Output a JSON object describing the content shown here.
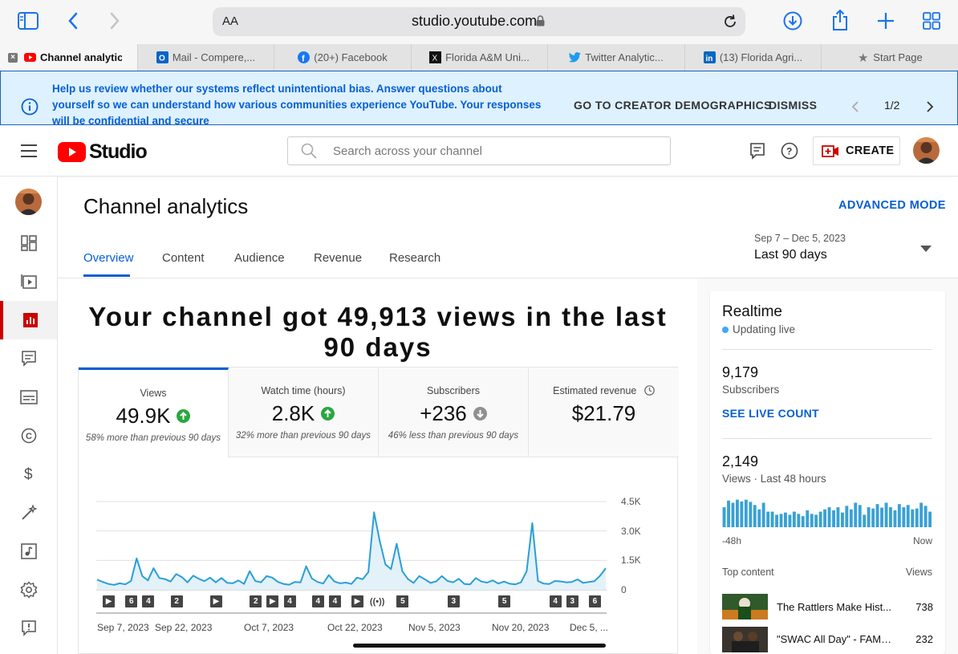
{
  "browser": {
    "text_size": "AA",
    "url": "studio.youtube.com",
    "tabs": [
      {
        "label": "Channel analytics",
        "favicon": "youtube-icon",
        "active": true
      },
      {
        "label": "Mail - Compere,...",
        "favicon": "outlook-icon"
      },
      {
        "label": "(20+) Facebook",
        "favicon": "facebook-icon"
      },
      {
        "label": "Florida A&M Uni...",
        "favicon": "x-icon"
      },
      {
        "label": "Twitter Analytic...",
        "favicon": "twitter-icon"
      },
      {
        "label": "(13) Florida Agri...",
        "favicon": "linkedin-icon"
      },
      {
        "label": "Start Page",
        "favicon": "star-icon"
      }
    ]
  },
  "banner": {
    "text": "Help us review whether our systems reflect unintentional bias. Answer questions about yourself so we can understand how various communities experience YouTube. Your responses will be confidential and secure",
    "primary_action": "GO TO CREATOR DEMOGRAPHICS",
    "dismiss": "DISMISS",
    "pager": "1/2"
  },
  "header": {
    "brand": "Studio",
    "search_placeholder": "Search across your channel",
    "create_label": "CREATE"
  },
  "sidebar": {
    "items": [
      {
        "icon": "dashboard-icon"
      },
      {
        "icon": "content-icon"
      },
      {
        "icon": "analytics-icon",
        "active": true
      },
      {
        "icon": "comments-icon"
      },
      {
        "icon": "subtitles-icon"
      },
      {
        "icon": "copyright-icon"
      },
      {
        "icon": "earn-icon"
      },
      {
        "icon": "customization-icon"
      },
      {
        "icon": "audio-library-icon"
      },
      {
        "icon": "settings-icon"
      },
      {
        "icon": "feedback-icon"
      }
    ]
  },
  "page": {
    "title": "Channel analytics",
    "advanced_mode": "ADVANCED MODE",
    "date_range_sub": "Sep 7 – Dec 5, 2023",
    "date_range": "Last 90 days",
    "tabs": [
      "Overview",
      "Content",
      "Audience",
      "Revenue",
      "Research"
    ],
    "headline": "Your channel got 49,913 views in the last 90 days"
  },
  "metrics": [
    {
      "label": "Views",
      "value": "49.9K",
      "trend": "up",
      "note": "58% more than previous 90 days"
    },
    {
      "label": "Watch time (hours)",
      "value": "2.8K",
      "trend": "up",
      "note": "32% more than previous 90 days"
    },
    {
      "label": "Subscribers",
      "value": "+236",
      "trend": "down",
      "note": "46% less than previous 90 days"
    },
    {
      "label": "Estimated revenue",
      "value": "$21.79",
      "trend": "none",
      "note": ""
    }
  ],
  "chart_data": {
    "type": "area",
    "y_ticks": [
      "4.5K",
      "3.0K",
      "1.5K",
      "0"
    ],
    "ylim": [
      0,
      4500
    ],
    "x_ticks": [
      "Sep 7, 2023",
      "Sep 22, 2023",
      "Oct 7, 2023",
      "Oct 22, 2023",
      "Nov 5, 2023",
      "Nov 20, 2023",
      "Dec 5, ..."
    ],
    "values": [
      520,
      400,
      300,
      250,
      330,
      280,
      450,
      1600,
      700,
      480,
      1100,
      600,
      550,
      420,
      800,
      650,
      380,
      720,
      560,
      440,
      620,
      380,
      600,
      360,
      330,
      480,
      300,
      950,
      450,
      380,
      700,
      620,
      400,
      300,
      260,
      400,
      380,
      1200,
      580,
      400,
      320,
      750,
      420,
      330,
      370,
      300,
      620,
      540,
      900,
      3950,
      2500,
      1300,
      1050,
      2350,
      950,
      550,
      350,
      700,
      530,
      350,
      430,
      700,
      450,
      380,
      560,
      300,
      280,
      600,
      420,
      370,
      480,
      320,
      420,
      310,
      280,
      380,
      950,
      3400,
      450,
      320,
      300,
      450,
      430,
      380,
      400,
      530,
      350,
      400,
      440,
      720,
      1100
    ],
    "markers": [
      {
        "pos": 2,
        "label": "▶"
      },
      {
        "pos": 6,
        "label": "6"
      },
      {
        "pos": 9,
        "label": "4"
      },
      {
        "pos": 14,
        "label": "2"
      },
      {
        "pos": 21,
        "label": "▶"
      },
      {
        "pos": 28,
        "label": "2"
      },
      {
        "pos": 31,
        "label": "▶"
      },
      {
        "pos": 34,
        "label": "4"
      },
      {
        "pos": 39,
        "label": "4"
      },
      {
        "pos": 42,
        "label": "4"
      },
      {
        "pos": 46,
        "label": "▶"
      },
      {
        "pos": 49,
        "label": "(•)"
      },
      {
        "pos": 54,
        "label": "5"
      },
      {
        "pos": 63,
        "label": "3"
      },
      {
        "pos": 72,
        "label": "5"
      },
      {
        "pos": 81,
        "label": "4"
      },
      {
        "pos": 84,
        "label": "3"
      },
      {
        "pos": 88,
        "label": "6"
      }
    ]
  },
  "realtime": {
    "title": "Realtime",
    "status": "Updating live",
    "subscribers": "9,179",
    "subscribers_label": "Subscribers",
    "see_live": "SEE LIVE COUNT",
    "views": "2,149",
    "views_label": "Views · Last 48 hours",
    "bar_start": "-48h",
    "bar_end": "Now",
    "hourly_views": [
      45,
      60,
      55,
      62,
      58,
      62,
      57,
      50,
      40,
      55,
      35,
      35,
      28,
      30,
      33,
      28,
      35,
      30,
      25,
      38,
      30,
      28,
      35,
      40,
      45,
      38,
      45,
      33,
      48,
      40,
      55,
      50,
      28,
      45,
      42,
      52,
      44,
      55,
      45,
      38,
      52,
      45,
      50,
      40,
      42,
      55,
      48,
      35
    ],
    "top_content_label": "Top content",
    "views_col": "Views",
    "top_content": [
      {
        "title": "The Rattlers Make Hist...",
        "views": "738"
      },
      {
        "title": "\"SWAC All Day\" - FAMU ...",
        "views": "232"
      }
    ]
  }
}
